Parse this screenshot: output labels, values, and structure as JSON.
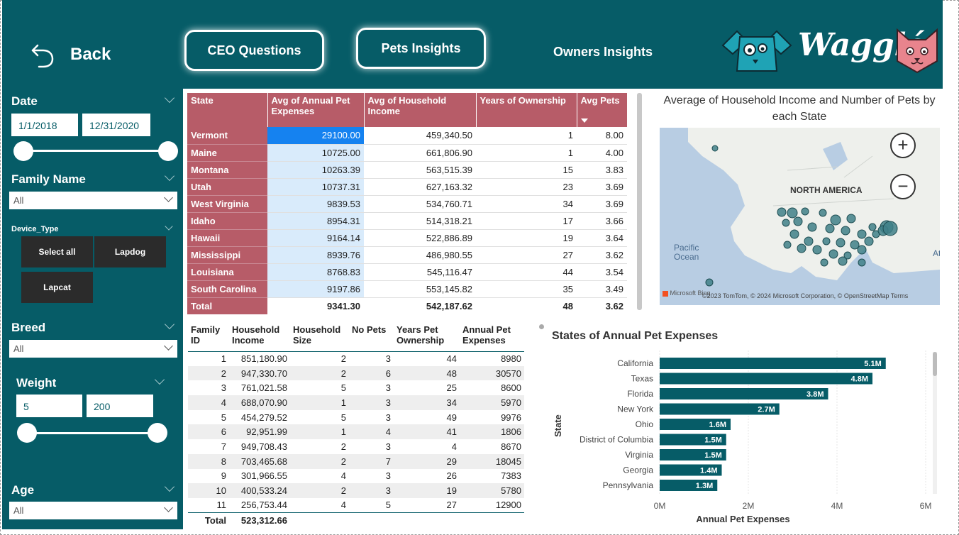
{
  "header": {
    "back_label": "Back",
    "nav": [
      {
        "label": "CEO Questions"
      },
      {
        "label": "Pets Insights"
      },
      {
        "label": "Owners Insights"
      }
    ],
    "logo_text": "Wagglé",
    "colors": {
      "header_bg": "#065c67",
      "accent_rose": "#b75c68",
      "dog_teal": "#1fa3b5",
      "cat_pink": "#e8848d"
    }
  },
  "filters": {
    "date": {
      "label": "Date",
      "start": "1/1/2018",
      "end": "12/31/2020"
    },
    "family_name": {
      "label": "Family Name",
      "value": "All"
    },
    "device_type": {
      "label": "Device_Type",
      "tiles": [
        "Select all",
        "Lapdog",
        "Lapcat"
      ]
    },
    "breed": {
      "label": "Breed",
      "value": "All"
    },
    "weight": {
      "label": "Weight",
      "min": "5",
      "max": "200"
    },
    "age": {
      "label": "Age",
      "value": "All"
    }
  },
  "state_table": {
    "columns": [
      "State",
      "Avg of Annual Pet Expenses",
      "Avg of Household Income",
      "Years of Ownership",
      "Avg Pets"
    ],
    "rows": [
      {
        "state": "Vermont",
        "exp": "29100.00",
        "income": "459,340.50",
        "years": "1",
        "pets": "8.00"
      },
      {
        "state": "Maine",
        "exp": "10725.00",
        "income": "661,806.90",
        "years": "1",
        "pets": "4.00"
      },
      {
        "state": "Montana",
        "exp": "10263.39",
        "income": "563,515.39",
        "years": "15",
        "pets": "3.83"
      },
      {
        "state": "Utah",
        "exp": "10737.31",
        "income": "627,163.32",
        "years": "23",
        "pets": "3.69"
      },
      {
        "state": "West Virginia",
        "exp": "9839.53",
        "income": "534,760.71",
        "years": "34",
        "pets": "3.69"
      },
      {
        "state": "Idaho",
        "exp": "8954.31",
        "income": "514,318.21",
        "years": "17",
        "pets": "3.66"
      },
      {
        "state": "Hawaii",
        "exp": "9164.14",
        "income": "522,886.89",
        "years": "19",
        "pets": "3.64"
      },
      {
        "state": "Mississippi",
        "exp": "8939.76",
        "income": "486,980.55",
        "years": "27",
        "pets": "3.62"
      },
      {
        "state": "Louisiana",
        "exp": "8768.83",
        "income": "545,116.47",
        "years": "44",
        "pets": "3.54"
      },
      {
        "state": "South Carolina",
        "exp": "9197.86",
        "income": "553,145.82",
        "years": "35",
        "pets": "3.49"
      }
    ],
    "total": {
      "state": "Total",
      "exp": "9341.30",
      "income": "542,187.62",
      "years": "48",
      "pets": "3.62"
    }
  },
  "map": {
    "title": "Average of Household Income and Number of Pets by each State",
    "region_label": "NORTH AMERICA",
    "ocean_label": "Pacific Ocean",
    "edge_label": "At",
    "zoom_in": "+",
    "zoom_out": "−",
    "attribution": "©2023 TomTom, © 2024 Microsoft Corporation, © OpenStreetMap  Terms",
    "brand": "Microsoft Bing"
  },
  "family_table": {
    "columns": [
      "Family ID",
      "Household Income",
      "Household Size",
      "No Pets",
      "Years Pet Ownership",
      "Annual Pet Expenses"
    ],
    "rows": [
      [
        "1",
        "851,180.90",
        "2",
        "3",
        "44",
        "8980"
      ],
      [
        "2",
        "947,330.70",
        "2",
        "6",
        "48",
        "30570"
      ],
      [
        "3",
        "761,021.58",
        "5",
        "3",
        "25",
        "8600"
      ],
      [
        "4",
        "688,070.90",
        "1",
        "3",
        "34",
        "5970"
      ],
      [
        "5",
        "454,279.52",
        "5",
        "3",
        "49",
        "9976"
      ],
      [
        "6",
        "92,951.99",
        "1",
        "4",
        "41",
        "1806"
      ],
      [
        "7",
        "949,708.43",
        "2",
        "3",
        "4",
        "8670"
      ],
      [
        "8",
        "703,465.68",
        "2",
        "7",
        "29",
        "18045"
      ],
      [
        "9",
        "301,966.55",
        "4",
        "3",
        "26",
        "7383"
      ],
      [
        "10",
        "400,533.24",
        "2",
        "3",
        "19",
        "5780"
      ],
      [
        "11",
        "256,753.44",
        "4",
        "5",
        "27",
        "12900"
      ]
    ],
    "total_label": "Total",
    "total_income": "523,312.66"
  },
  "chart_data": {
    "type": "bar",
    "orientation": "horizontal",
    "title": "States of Annual Pet Expenses",
    "xlabel": "Annual Pet Expenses",
    "ylabel": "State",
    "categories": [
      "California",
      "Texas",
      "Florida",
      "New York",
      "Ohio",
      "District of Columbia",
      "Virginia",
      "Georgia",
      "Pennsylvania"
    ],
    "values": [
      5.1,
      4.8,
      3.8,
      2.7,
      1.6,
      1.5,
      1.5,
      1.4,
      1.3
    ],
    "value_labels": [
      "5.1M",
      "4.8M",
      "3.8M",
      "2.7M",
      "1.6M",
      "1.5M",
      "1.5M",
      "1.4M",
      "1.3M"
    ],
    "xticks": [
      "0M",
      "2M",
      "4M",
      "6M"
    ],
    "xlim": [
      0,
      6
    ],
    "unit": "M",
    "bar_color": "#065c67",
    "grid": true
  }
}
